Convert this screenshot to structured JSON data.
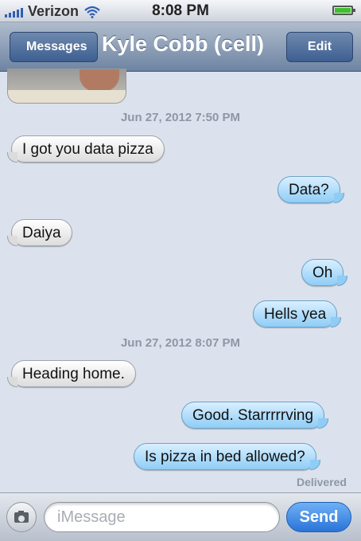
{
  "status_bar": {
    "carrier": "Verizon",
    "time": "8:08 PM"
  },
  "nav": {
    "back_label": "Messages",
    "title": "Kyle Cobb (cell)",
    "edit_label": "Edit"
  },
  "thread": {
    "timestamp_1": "Jun 27, 2012 7:50 PM",
    "timestamp_2": "Jun 27, 2012 8:07 PM",
    "messages": [
      {
        "text": "I got you data pizza",
        "from": "received"
      },
      {
        "text": "Data?",
        "from": "sent"
      },
      {
        "text": "Daiya",
        "from": "received"
      },
      {
        "text": "Oh",
        "from": "sent"
      },
      {
        "text": "Hells yea",
        "from": "sent"
      },
      {
        "text": "Heading home.",
        "from": "received"
      },
      {
        "text": "Good. Starrrrrving",
        "from": "sent"
      },
      {
        "text": "Is pizza in bed allowed?",
        "from": "sent"
      }
    ],
    "delivered": "Delivered"
  },
  "composer": {
    "placeholder": "iMessage",
    "value": "",
    "send_label": "Send"
  },
  "colors": {
    "nav": "#6d84a2",
    "sent_bubble": "#8fcdf6",
    "received_bubble": "#ffffff",
    "send_button": "#2a74d8",
    "background": "#dbe2ed"
  }
}
